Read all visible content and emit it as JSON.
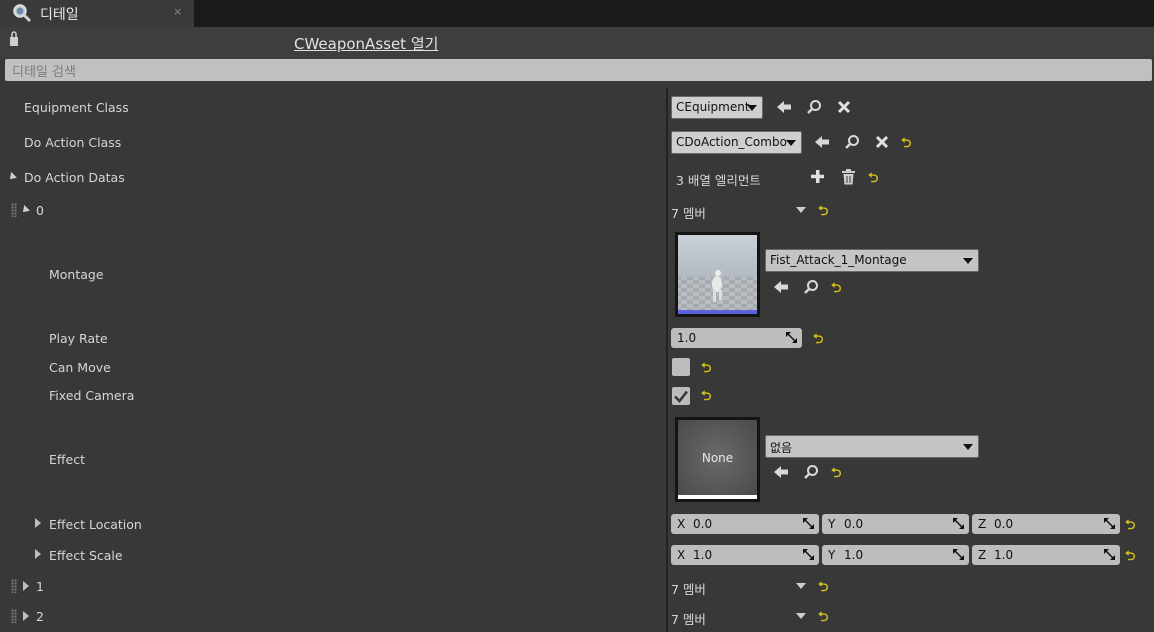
{
  "tab": {
    "label": "디테일",
    "close": "×"
  },
  "header": {
    "asset_link": "CWeaponAsset 열기",
    "search_placeholder": "디테일 검색"
  },
  "rows": {
    "equipment_class": {
      "label": "Equipment Class",
      "value": "CEquipment"
    },
    "do_action_class": {
      "label": "Do Action Class",
      "value": "CDoAction_Combo"
    },
    "do_action_datas": {
      "label": "Do Action Datas",
      "value": "3 배열 엘리먼트"
    },
    "item0": {
      "label": "0",
      "value": "7 멤버"
    },
    "montage": {
      "label": "Montage",
      "value": "Fist_Attack_1_Montage"
    },
    "play_rate": {
      "label": "Play Rate",
      "value": "1.0"
    },
    "can_move": {
      "label": "Can Move",
      "checked": false
    },
    "fixed_camera": {
      "label": "Fixed Camera",
      "checked": true
    },
    "effect": {
      "label": "Effect",
      "value": "없음",
      "thumb_text": "None"
    },
    "effect_location": {
      "label": "Effect Location",
      "x_axis": "X",
      "y_axis": "Y",
      "z_axis": "Z",
      "x": "0.0",
      "y": "0.0",
      "z": "0.0"
    },
    "effect_scale": {
      "label": "Effect Scale",
      "x_axis": "X",
      "y_axis": "Y",
      "z_axis": "Z",
      "x": "1.0",
      "y": "1.0",
      "z": "1.0"
    },
    "item1": {
      "label": "1",
      "value": "7 멤버"
    },
    "item2": {
      "label": "2",
      "value": "7 멤버"
    }
  },
  "reset_glyph": "⮌",
  "icons": [
    "details-magnifier-icon",
    "lock-icon",
    "use-selected-arrow-icon",
    "browse-magnifier-icon",
    "clear-x-icon",
    "add-plus-icon",
    "trash-icon",
    "reset-to-default-icon",
    "spin-arrows-icon",
    "drag-grip-icon",
    "checkmark-icon"
  ],
  "colors": {
    "background": "#383838",
    "accent_reset": "#d7c21c",
    "montage_underline": "#5c63d8",
    "effect_underline": "#ffffff"
  }
}
